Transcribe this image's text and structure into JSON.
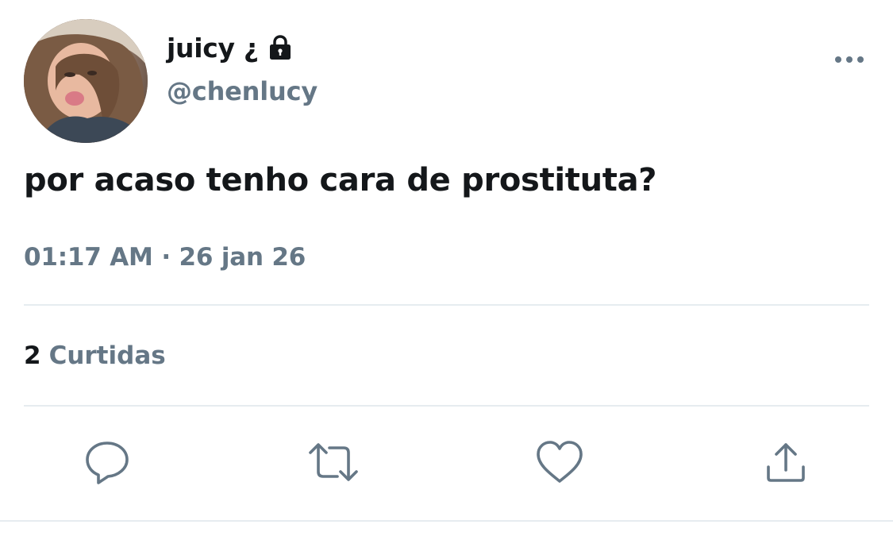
{
  "tweet": {
    "display_name": "juicy ¿",
    "handle": "@chenlucy",
    "text": "por acaso tenho cara de prostituta?",
    "time": "01:17 AM",
    "separator": "·",
    "date": "26 jan 26",
    "likes_count": "2",
    "likes_label": "Curtidas"
  },
  "icons": {
    "lock": "lock-icon",
    "more": "more-options-icon",
    "reply": "reply-icon",
    "retweet": "retweet-icon",
    "like": "heart-icon",
    "share": "share-icon"
  },
  "colors": {
    "text_primary": "#14171a",
    "text_secondary": "#657786",
    "divider": "#e6ecf0",
    "icon": "#657786"
  }
}
